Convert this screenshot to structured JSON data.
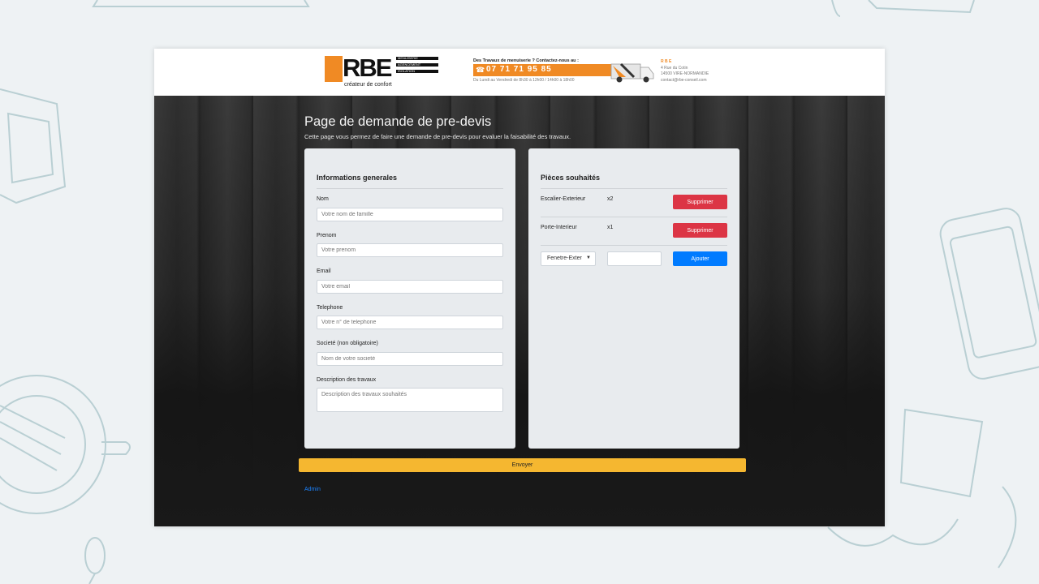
{
  "header": {
    "logo_text": "RBE",
    "logo_tagline": "créateur de confort",
    "logo_bars": [
      "MENUISERIE",
      "AGENCEMENT",
      "ISOLATION"
    ],
    "contact_question": "Des Travaux de menuiserie ? Contactez-nous au :",
    "phone": "07 71 71 95 85",
    "hours": "Du Lundi au Vendredi de 8h30 à 12h00 / 14h00 à 18h00",
    "address_name": "R B E",
    "address_lines": [
      "4 Rue du Cotin",
      "14500 VIRE-NORMANDIE",
      "contact@rbe-conseil.com"
    ]
  },
  "page": {
    "title": "Page de demande de pre-devis",
    "subtitle": "Cette page vous permez de faire une demande de pre-devis pour evaluer la faisabilité des travaux."
  },
  "general_info": {
    "title": "Informations generales",
    "fields": [
      {
        "label": "Nom",
        "placeholder": "Votre nom de famille"
      },
      {
        "label": "Prenom",
        "placeholder": "Votre prenom"
      },
      {
        "label": "Email",
        "placeholder": "Votre email"
      },
      {
        "label": "Telephone",
        "placeholder": "Votre n° de telephone"
      },
      {
        "label": "Societé (non obligatoire)",
        "placeholder": "Nom de votre societé"
      },
      {
        "label": "Description des travaux",
        "placeholder": "Description des travaux souhaités"
      }
    ]
  },
  "pieces": {
    "title": "Pièces souhaités",
    "items": [
      {
        "name": "Escalier-Exterieur",
        "qty": "x2",
        "remove_label": "Supprimer"
      },
      {
        "name": "Porte-Interieur",
        "qty": "x1",
        "remove_label": "Supprimer"
      }
    ],
    "select_value": "Fenetre-Exter",
    "add_label": "Ajouter"
  },
  "submit_label": "Envoyer",
  "admin_label": "Admin",
  "colors": {
    "accent_orange": "#f08a24",
    "danger": "#dc3545",
    "primary": "#007bff",
    "submit": "#f5b730",
    "link": "#1a82ff"
  },
  "icons": {
    "phone": "phone-icon",
    "select_arrow": "chevron-down-icon"
  }
}
